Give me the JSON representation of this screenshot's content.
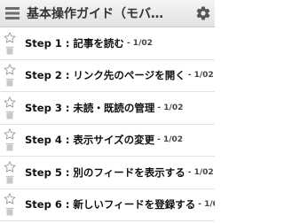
{
  "header": {
    "title": "基本操作ガイド（モバ…",
    "menu_icon": "hamburger-icon",
    "settings_icon": "gear-icon"
  },
  "items": [
    {
      "title": "Step 1 : 記事を読む",
      "meta": "- 1/02"
    },
    {
      "title": "Step 2 : リンク先のページを開く",
      "meta": "- 1/02"
    },
    {
      "title": "Step 3 : 未読・既読の管理",
      "meta": "- 1/02"
    },
    {
      "title": "Step 4 : 表示サイズの変更",
      "meta": "- 1/02"
    },
    {
      "title": "Step 5 : 別のフィードを表示する",
      "meta": "- 1/02"
    },
    {
      "title": "Step 6 : 新しいフィードを登録する",
      "meta": "- 1/02"
    }
  ],
  "colors": {
    "icon_gray": "#8c8c8c",
    "separator": "#e3e3e3"
  }
}
